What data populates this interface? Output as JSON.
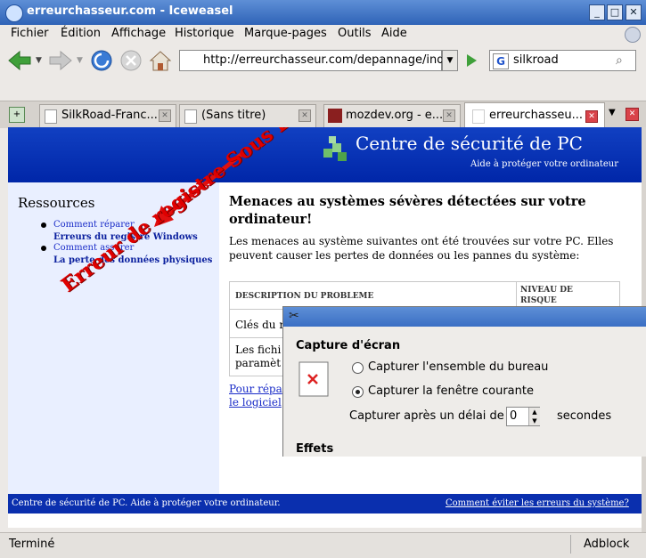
{
  "window": {
    "title": "erreurchasseur.com - Iceweasel"
  },
  "menu": [
    "Fichier",
    "Édition",
    "Affichage",
    "Historique",
    "Marque-pages",
    "Outils",
    "Aide"
  ],
  "nav": {
    "url": "http://erreurchasseur.com/depannage/ind",
    "search_value": "silkroad",
    "search_engine_icon": "G"
  },
  "tabs": [
    {
      "label": "SilkRoad-Franc..."
    },
    {
      "label": "(Sans titre)"
    },
    {
      "label": "mozdev.org - e..."
    },
    {
      "label": "erreurchasseu..."
    }
  ],
  "page": {
    "banner_title": "Centre de sécurité de PC",
    "banner_subtitle": "Aide à protéger votre ordinateur",
    "sidebar": {
      "heading": "Ressources",
      "items": [
        {
          "small": "Comment réparer",
          "bold": "Erreurs du registre Windows"
        },
        {
          "small": "Comment assurer",
          "bold": "La perte des données physiques"
        }
      ]
    },
    "main": {
      "heading_line1": "Menaces au systèmes sévères détectées sur votre",
      "heading_line2": "ordinateur!",
      "intro_line1": "Les menaces au système suivantes ont été trouvées sur votre PC. Elles",
      "intro_line2": "peuvent causer les pertes de données ou les pannes du système:",
      "table_header_desc": "DESCRIPTION DU PROBLEME",
      "table_header_level_1": "NIVEAU DE",
      "table_header_level_2": "RISQUE",
      "row1": "Clés du r",
      "row2_line1": "Les fichi",
      "row2_line2": "paramèt",
      "link_line1": "Pour répa",
      "link_line2": "le logiciel"
    },
    "footer_left": "Centre de sécurité de PC. Aide à protéger votre ordinateur.",
    "footer_right": "Comment éviter les erreurs du système?",
    "annotation": "Erreur de registre Sous Linux !!!"
  },
  "dialog": {
    "section_capture": "Capture d'écran",
    "option_desktop": "Capturer l'ensemble du bureau",
    "option_window": "Capturer la fenêtre courante",
    "selected_option": "window",
    "delay_label": "Capturer après un délai de",
    "delay_value": "0",
    "delay_unit": "secondes",
    "section_effects": "Effets"
  },
  "status": {
    "text": "Terminé",
    "addon": "Adblock"
  },
  "colors": {
    "banner": "#0026a8",
    "annotation": "#e00000",
    "arrow": "#e01010",
    "link": "#1a2cc8"
  }
}
